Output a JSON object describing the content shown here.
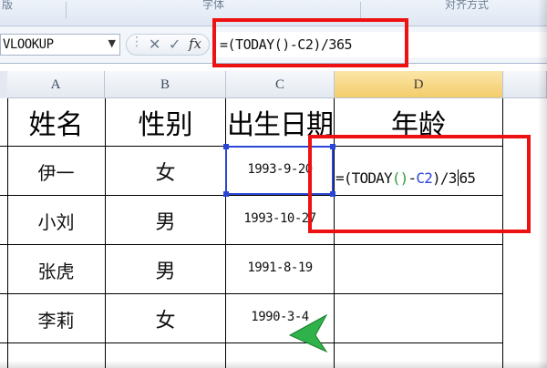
{
  "ribbon": {
    "fragments": [
      "版",
      "字体",
      "对齐方式"
    ]
  },
  "formula_bar": {
    "name_box": "VLOOKUP",
    "dropdown_glyph": "▼",
    "cancel_glyph": "✕",
    "enter_glyph": "✓",
    "fx_label": "fx",
    "formula": "=(TODAY()-C2)/365"
  },
  "columns": [
    "A",
    "B",
    "C",
    "D"
  ],
  "headers": {
    "name": "姓名",
    "sex": "性别",
    "birth": "出生日期",
    "age": "年龄"
  },
  "rows": [
    {
      "name": "伊一",
      "sex": "女",
      "birth": "1993-9-20"
    },
    {
      "name": "小刘",
      "sex": "男",
      "birth": "1993-10-27"
    },
    {
      "name": "张虎",
      "sex": "男",
      "birth": "1991-8-19"
    },
    {
      "name": "李莉",
      "sex": "女",
      "birth": "1990-3-4"
    },
    {
      "name": "",
      "sex": "",
      "birth": ""
    }
  ],
  "cell_edit": {
    "prefix": "=(TODAY",
    "paren": "()",
    "minus": "-",
    "ref": "C2",
    "close": ")/3",
    "tail": "65"
  },
  "colors": {
    "highlight_red": "#ee1111",
    "selection_blue": "#2a46d6",
    "paren_green": "#2e9b3a",
    "active_col": "#f4cc6a"
  },
  "icons": {
    "pointer": "green-arrow-pointer-icon"
  }
}
